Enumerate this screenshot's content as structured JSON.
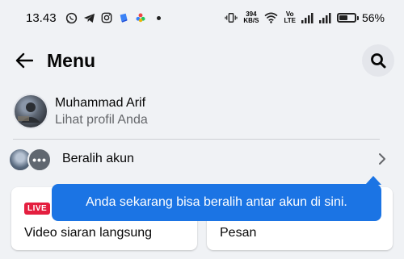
{
  "status_bar": {
    "time": "13.43",
    "network_speed_value": "394",
    "network_speed_unit": "KB/S",
    "volte_top": "Vo",
    "volte_bottom": "LTE",
    "battery_percent": "56%",
    "battery_level": 0.56,
    "icons": [
      "whatsapp-icon",
      "telegram-icon",
      "instagram-icon",
      "app-icon",
      "photos-icon",
      "notification-dot",
      "vibrate-icon",
      "wifi-icon",
      "signal-icon",
      "signal-icon",
      "battery-icon"
    ]
  },
  "header": {
    "title": "Menu",
    "back_icon": "arrow-left-icon",
    "search_icon": "search-icon"
  },
  "profile": {
    "name": "Muhammad Arif",
    "subtitle": "Lihat profil Anda"
  },
  "switch_account": {
    "label": "Beralih akun",
    "more_glyph": "•••"
  },
  "shortcuts": [
    {
      "badge": "LIVE",
      "label": "Video siaran langsung"
    },
    {
      "label": "Pesan"
    }
  ],
  "tooltip": {
    "text": "Anda sekarang bisa beralih antar akun di sini."
  },
  "colors": {
    "background": "#f0f2f5",
    "tooltip": "#1b74e4",
    "live_badge": "#e41e3f",
    "secondary_text": "#65676b"
  }
}
